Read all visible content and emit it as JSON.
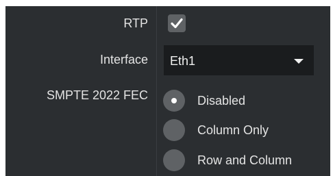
{
  "fields": {
    "rtp": {
      "label": "RTP",
      "checked": true
    },
    "interface": {
      "label": "Interface",
      "selected": "Eth1"
    },
    "fec": {
      "label": "SMPTE 2022 FEC",
      "options": [
        {
          "label": "Disabled",
          "selected": true
        },
        {
          "label": "Column Only",
          "selected": false
        },
        {
          "label": "Row and Column",
          "selected": false
        }
      ]
    }
  },
  "icons": {
    "checkbox": "check-icon",
    "dropdown": "chevron-down-icon"
  },
  "colors": {
    "panel_background": "#2b2e31",
    "control_fill": "#5f6265",
    "select_background": "#1a1c1e",
    "text": "#e4e4e4"
  }
}
